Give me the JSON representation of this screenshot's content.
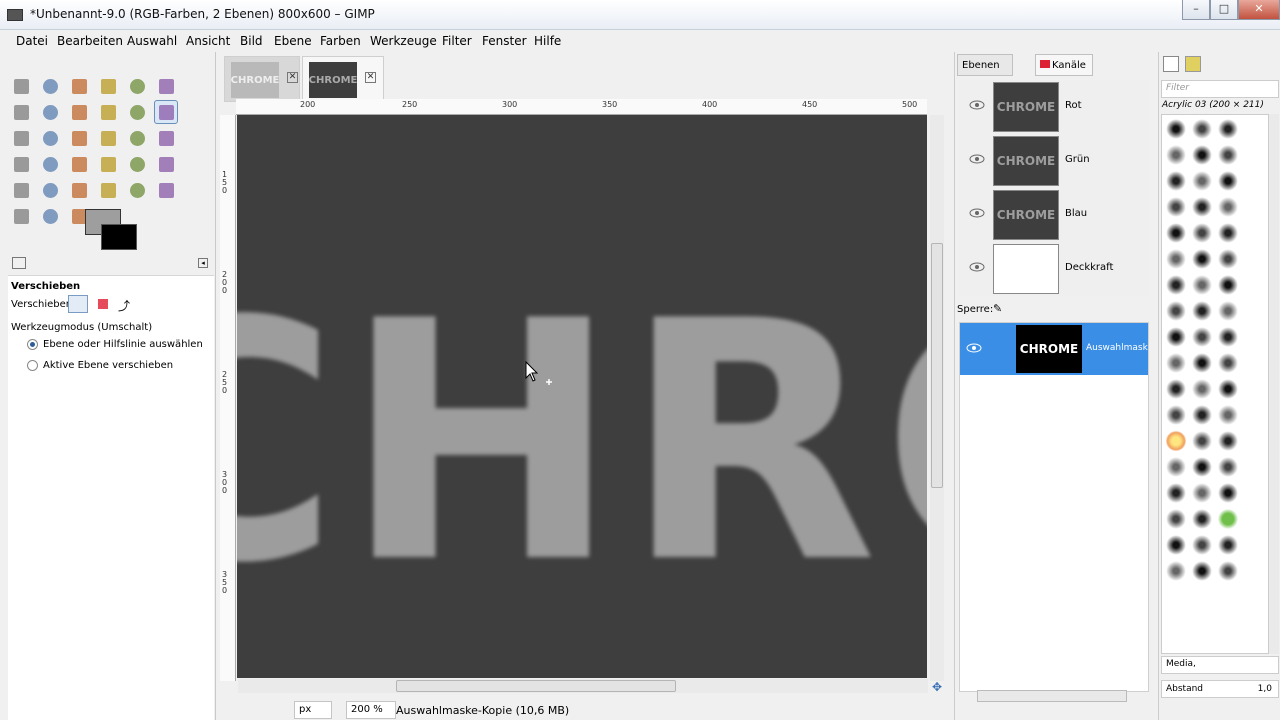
{
  "window": {
    "title": "*Unbenannt-9.0 (RGB-Farben, 2 Ebenen) 800x600 – GIMP",
    "minimize": "–",
    "maximize": "□",
    "close": "✕"
  },
  "menu": [
    "Datei",
    "Bearbeiten",
    "Auswahl",
    "Ansicht",
    "Bild",
    "Ebene",
    "Farben",
    "Werkzeuge",
    "Filter",
    "Fenster",
    "Hilfe"
  ],
  "toolbox": {
    "tools": [
      "rect-select",
      "ellipse-select",
      "free-select",
      "fuzzy-select",
      "select-by-color",
      "scissors",
      "foreground-select",
      "paths",
      "color-picker",
      "zoom",
      "measure",
      "move",
      "align",
      "crop",
      "rotate",
      "scale",
      "shear",
      "perspective",
      "flip",
      "cage",
      "text",
      "bucket-fill",
      "blend",
      "pencil",
      "paintbrush",
      "eraser",
      "airbrush",
      "ink",
      "clone",
      "heal",
      "perspective-clone",
      "blur",
      "smudge",
      "dodge-burn"
    ],
    "fg_color": "#9e9e9e",
    "bg_color": "#000000"
  },
  "tool_options": {
    "title": "Verschieben",
    "move_label": "Verschieben:",
    "mode_label": "Werkzeugmodus (Umschalt)",
    "option1": "Ebene oder Hilfslinie auswählen",
    "option2": "Aktive Ebene verschieben",
    "selected_option": 1
  },
  "image_tabs": [
    {
      "thumb": "CHROME",
      "active": false
    },
    {
      "thumb": "CHROME",
      "active": true
    }
  ],
  "rulers": {
    "h": [
      "200",
      "250",
      "300",
      "350",
      "400",
      "450",
      "500"
    ],
    "v": [
      "1 5 0",
      "2 0 0",
      "2 5 0",
      "3 0 0",
      "3 5 0"
    ]
  },
  "canvas": {
    "text": "CHROM"
  },
  "status": {
    "unit": "px",
    "zoom": "200 %",
    "info": "Auswahlmaske-Kopie (10,6 MB)"
  },
  "channels_dock": {
    "tabs": [
      "Ebenen",
      "Kanäle"
    ],
    "channels": [
      {
        "thumb": "CHROME",
        "label": "Rot"
      },
      {
        "thumb": "CHROME",
        "label": "Grün"
      },
      {
        "thumb": "CHROME",
        "label": "Blau"
      },
      {
        "thumb": "",
        "label": "Deckkraft"
      }
    ],
    "lock_label": "Sperre:",
    "selection": {
      "thumb": "CHROME",
      "label": "Auswahlmaske"
    }
  },
  "brushes_dock": {
    "filter_placeholder": "Filter",
    "brush_name": "Acrylic 03 (200 × 211)",
    "mode": "Media,",
    "spacing_label": "Abstand",
    "spacing_value": "1,0"
  },
  "colors": {
    "selection": "#3a8ee6",
    "canvas": "#3e3e3e",
    "text": "#9d9d9d"
  }
}
